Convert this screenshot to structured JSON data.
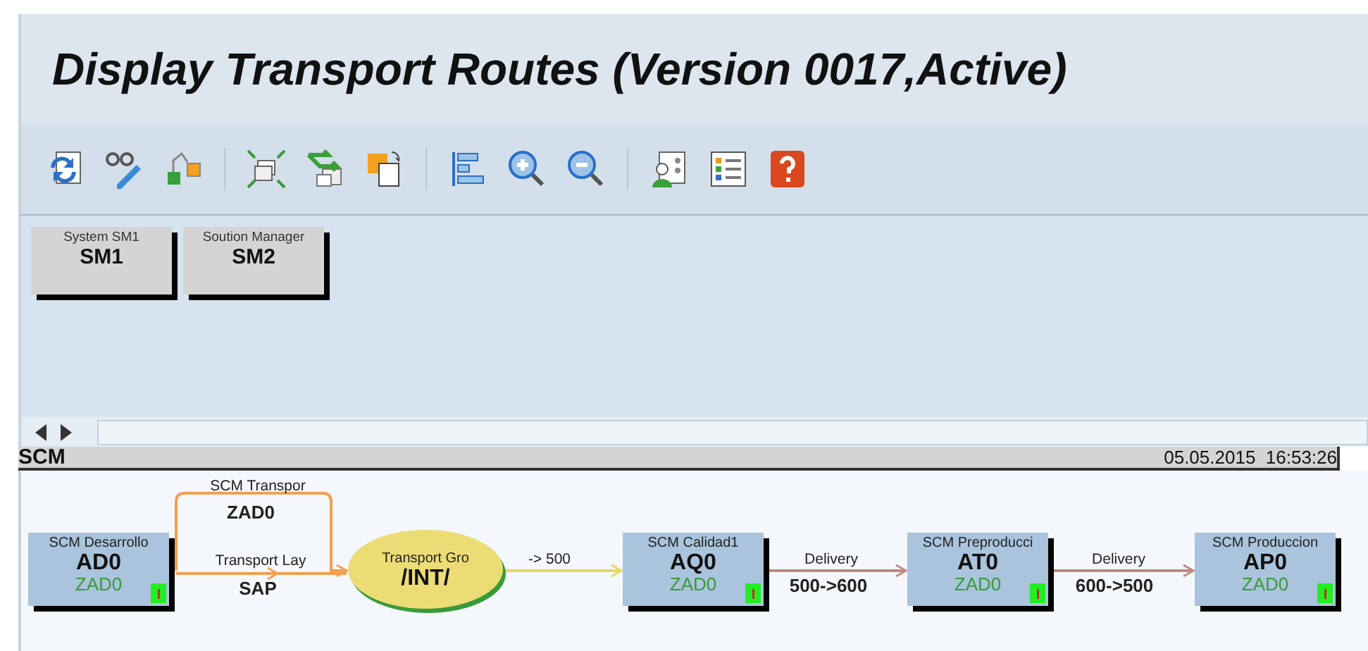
{
  "title": "Display Transport Routes (Version 0017,Active)",
  "systems": [
    {
      "caption": "System SM1",
      "sid": "SM1"
    },
    {
      "caption": "Soution Manager",
      "sid": "SM2"
    }
  ],
  "domain": {
    "name": "SCM",
    "timestamp": "05.05.2015  16:53:26"
  },
  "nodes": [
    {
      "kind": "system",
      "caption": "SCM Desarrollo",
      "sid": "AD0",
      "client": "ZAD0"
    },
    {
      "kind": "group",
      "caption": "Transport Gro",
      "sid": "/INT/"
    },
    {
      "kind": "system",
      "caption": "SCM Calidad1",
      "sid": "AQ0",
      "client": "ZAD0"
    },
    {
      "kind": "system",
      "caption": "SCM Preproducci",
      "sid": "AT0",
      "client": "ZAD0"
    },
    {
      "kind": "system",
      "caption": "SCM Produccion",
      "sid": "AP0",
      "client": "ZAD0"
    }
  ],
  "routes": [
    {
      "top": "SCM Transpor",
      "bottom": "ZAD0",
      "color": "#f0a050"
    },
    {
      "top": "Transport Lay",
      "bottom": "SAP",
      "color": "#f0a050"
    },
    {
      "top": "-> 500",
      "color": "#e8d860"
    },
    {
      "top": "Delivery",
      "bottom": "500->600",
      "color": "#c08a80"
    },
    {
      "top": "Delivery",
      "bottom": "600->500",
      "color": "#c08a80"
    }
  ]
}
